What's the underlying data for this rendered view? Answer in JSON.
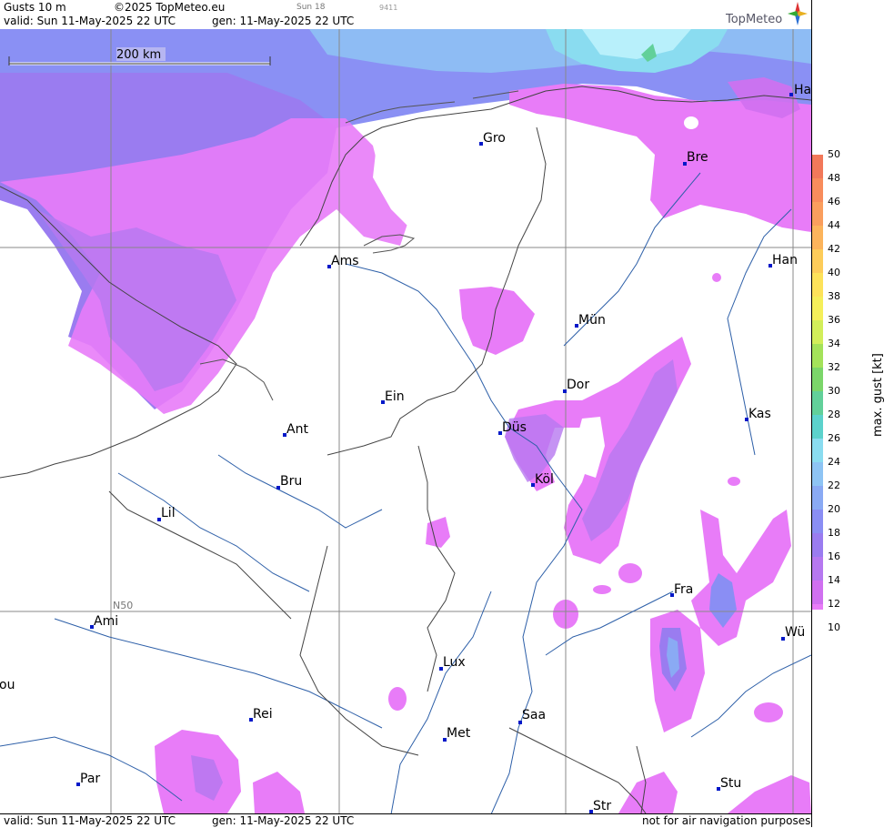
{
  "header": {
    "title": "Gusts 10 m",
    "copyright": "©2025 TopMeteo.eu",
    "valid": "valid:  Sun  11-May-2025  22 UTC",
    "generated": "gen: 11-May-2025 22 UTC",
    "sun_tag": "Sun 18",
    "code": "9411",
    "logo_text": "TopMeteo"
  },
  "footer": {
    "valid": "valid:  Sun  11-May-2025  22 UTC",
    "generated": "gen: 11-May-2025 22 UTC",
    "disclaimer": "not for air navigation purposes"
  },
  "map": {
    "scale_label": "200 km",
    "graticule_label": "N50",
    "cities": [
      {
        "name": "Ha"
      },
      {
        "name": "Gro"
      },
      {
        "name": "Bre"
      },
      {
        "name": "Ams"
      },
      {
        "name": "Han"
      },
      {
        "name": "Mün"
      },
      {
        "name": "Dor"
      },
      {
        "name": "Ein"
      },
      {
        "name": "Ant"
      },
      {
        "name": "Düs"
      },
      {
        "name": "Kas"
      },
      {
        "name": "Köl"
      },
      {
        "name": "Bru"
      },
      {
        "name": "Lil"
      },
      {
        "name": "Fra"
      },
      {
        "name": "Ami"
      },
      {
        "name": "Wü"
      },
      {
        "name": "Lux"
      },
      {
        "name": "ou"
      },
      {
        "name": "Rei"
      },
      {
        "name": "Saa"
      },
      {
        "name": "Met"
      },
      {
        "name": "Par"
      },
      {
        "name": "Stu"
      },
      {
        "name": "Str"
      }
    ]
  },
  "legend": {
    "title": "max. gust  [kt]",
    "ticks": [
      "50",
      "48",
      "46",
      "44",
      "42",
      "40",
      "38",
      "36",
      "34",
      "32",
      "30",
      "28",
      "26",
      "24",
      "22",
      "20",
      "18",
      "16",
      "14",
      "12",
      "10"
    ],
    "colors": {
      "c50": "#f2785a",
      "c48": "#f88c5c",
      "c46": "#fa9e5e",
      "c44": "#fcb45c",
      "c42": "#fdcc5a",
      "c40": "#fde25a",
      "c38": "#f5ef5a",
      "c36": "#d2ee5a",
      "c34": "#a4e25a",
      "c32": "#7bd66a",
      "c30": "#62d09a",
      "c28": "#5cd2cc",
      "c26": "#8adcf0",
      "c24": "#8ec4f4",
      "c22": "#8aaaf4",
      "c20": "#8a8ef4",
      "c18": "#9a7cf0",
      "c16": "#b678f0",
      "c14": "#d070f0",
      "c12": "#e87cf8"
    }
  }
}
